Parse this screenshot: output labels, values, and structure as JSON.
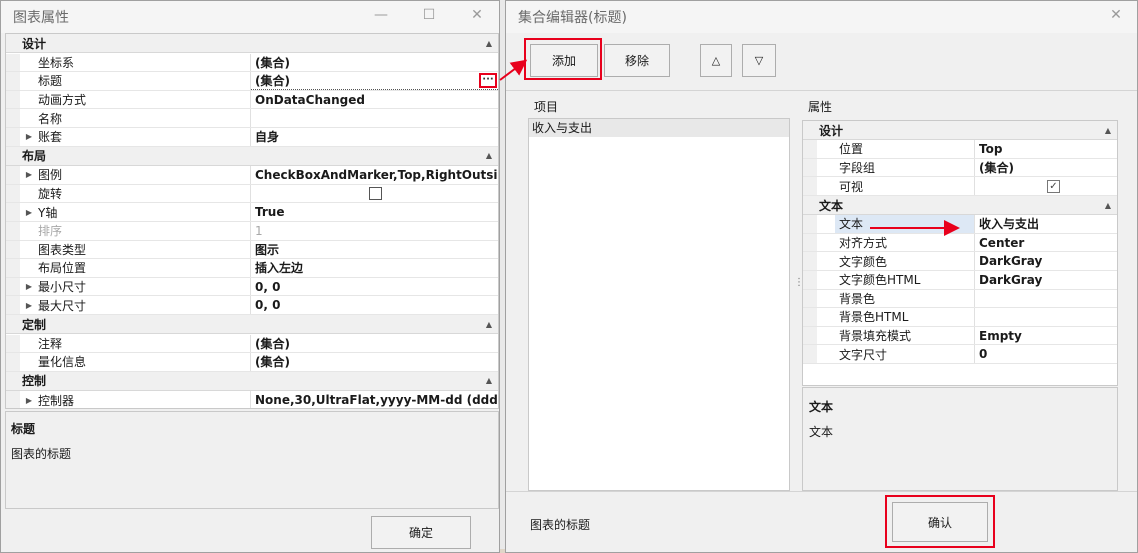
{
  "left": {
    "title": "图表属性",
    "controls": {
      "minimize": "—",
      "maximize": "☐",
      "close": "✕"
    },
    "categories": [
      {
        "label": "设计",
        "rows": [
          {
            "name": "坐标系",
            "value": "(集合)",
            "expand": false
          },
          {
            "name": "标题",
            "value": "(集合)",
            "expand": false,
            "selected": true
          },
          {
            "name": "动画方式",
            "value": "OnDataChanged",
            "expand": false
          },
          {
            "name": "名称",
            "value": "",
            "expand": false
          },
          {
            "name": "账套",
            "value": "自身",
            "expand": true
          }
        ]
      },
      {
        "label": "布局",
        "rows": [
          {
            "name": "图例",
            "value": "CheckBoxAndMarker,Top,RightOutsi...",
            "expand": true
          },
          {
            "name": "旋转",
            "value": "",
            "checkbox": true,
            "expand": false
          },
          {
            "name": "Y轴",
            "value": "True",
            "expand": true
          },
          {
            "name": "排序",
            "value": "1",
            "expand": false,
            "disabled": true
          },
          {
            "name": "图表类型",
            "value": "图示",
            "expand": false
          },
          {
            "name": "布局位置",
            "value": "插入左边",
            "expand": false
          },
          {
            "name": "最小尺寸",
            "value": "0, 0",
            "expand": true
          },
          {
            "name": "最大尺寸",
            "value": "0, 0",
            "expand": true
          }
        ]
      },
      {
        "label": "定制",
        "rows": [
          {
            "name": "注释",
            "value": "(集合)",
            "expand": false
          },
          {
            "name": "量化信息",
            "value": "(集合)",
            "expand": false
          }
        ]
      },
      {
        "label": "控制",
        "rows": [
          {
            "name": "控制器",
            "value": "None,30,UltraFlat,yyyy-MM-dd (ddd)",
            "expand": true
          }
        ]
      }
    ],
    "ellipsis": "···",
    "description": {
      "title": "标题",
      "text": "图表的标题"
    },
    "ok_label": "确定"
  },
  "right": {
    "title": "集合编辑器(标题)",
    "close": "✕",
    "add_label": "添加",
    "remove_label": "移除",
    "up_label": "△",
    "down_label": "▽",
    "items_label": "项目",
    "items": [
      "收入与支出"
    ],
    "props_label": "属性",
    "splitter": "⋮",
    "categories": [
      {
        "label": "设计",
        "rows": [
          {
            "name": "位置",
            "value": "Top"
          },
          {
            "name": "字段组",
            "value": "(集合)"
          },
          {
            "name": "可视",
            "value": "✓",
            "checkbox": true
          }
        ]
      },
      {
        "label": "文本",
        "rows": [
          {
            "name": "文本",
            "value": "收入与支出",
            "highlight": true
          },
          {
            "name": "对齐方式",
            "value": "Center"
          },
          {
            "name": "文字颜色",
            "value": "DarkGray"
          },
          {
            "name": "文字颜色HTML",
            "value": "DarkGray"
          },
          {
            "name": "背景色",
            "value": ""
          },
          {
            "name": "背景色HTML",
            "value": ""
          },
          {
            "name": "背景填充模式",
            "value": "Empty"
          },
          {
            "name": "文字尺寸",
            "value": "0"
          }
        ]
      }
    ],
    "description": {
      "title": "文本",
      "text": "文本"
    },
    "footer_text": "图表的标题",
    "confirm_label": "确认"
  },
  "colors": {
    "highlight_red": "#e8001c",
    "selected_blue": "#dde8f5"
  }
}
